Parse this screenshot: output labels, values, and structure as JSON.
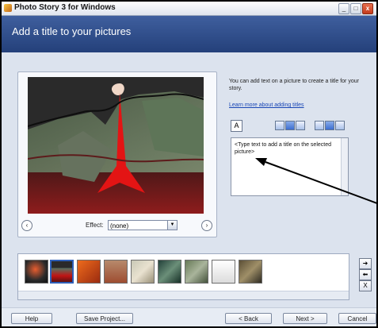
{
  "window": {
    "title": "Photo Story 3 for Windows",
    "minimize_icon": "_",
    "maximize_icon": "□",
    "close_icon": "x"
  },
  "header": {
    "title": "Add a title to your pictures"
  },
  "preview": {
    "effect_label": "Effect:",
    "effect_value": "(none)",
    "prev_icon": "‹",
    "next_icon": "›"
  },
  "help": {
    "text": "You can add text on a picture to create a title for your story.",
    "link": "Learn more about adding titles"
  },
  "editor": {
    "font_icon": "A",
    "placeholder": "<Type text to add a title on the selected picture>"
  },
  "filmstrip": {
    "move_right_icon": "➜",
    "move_left_icon": "⬅",
    "delete_icon": "X"
  },
  "footer": {
    "help": "Help",
    "save": "Save Project...",
    "back": "< Back",
    "next": "Next >",
    "cancel": "Cancel"
  },
  "colors": {
    "header_blue": "#24407a",
    "selected_thumb": "#2e5fb8",
    "pyramid_red": "#e31414"
  }
}
